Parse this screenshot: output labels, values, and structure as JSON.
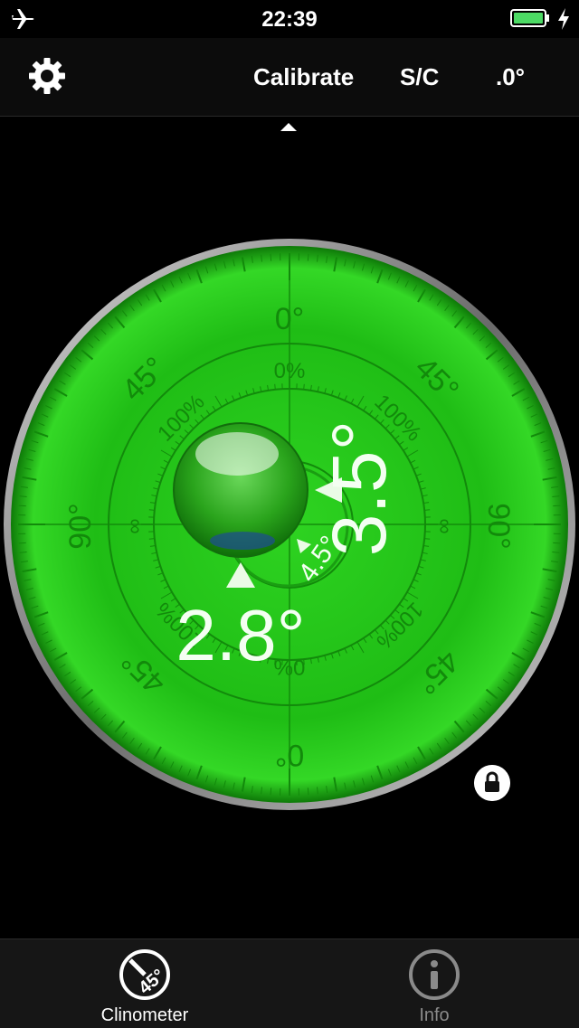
{
  "status_bar": {
    "time": "22:39"
  },
  "toolbar": {
    "calibrate_label": "Calibrate",
    "sc_label": "S/C",
    "precision_label": ".0°"
  },
  "level": {
    "color": "#22c418",
    "top_scale": "0°",
    "bottom_scale": "0°",
    "left_scale": "90°",
    "right_scale": "90°",
    "diag_scale": "45°",
    "inner_top": "0%",
    "inner_bottom": "0%",
    "inner_diag": "100%",
    "infinity": "∞",
    "x_angle": "2.8°",
    "y_angle": "3.5°",
    "combined_angle": "4.5°"
  },
  "tabs": [
    {
      "label": "Clinometer",
      "icon_text": "45°",
      "active": true
    },
    {
      "label": "Info",
      "active": false
    }
  ]
}
